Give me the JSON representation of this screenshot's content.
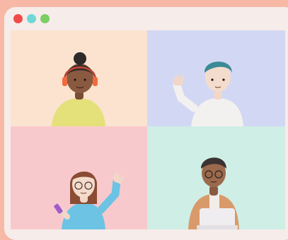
{
  "colors": {
    "background": "#f7b9a6",
    "window": "#f6ecea",
    "close": "#f04a4a",
    "minimize": "#6fd8d6",
    "maximize": "#7ccf62",
    "tile_1": "#fbe3cf",
    "tile_2": "#d2d8f3",
    "tile_3": "#f8c9cc",
    "tile_4": "#cfeee6"
  },
  "titlebar": {
    "controls": [
      "close-icon",
      "minimize-icon",
      "maximize-icon"
    ]
  },
  "grid": {
    "tiles": [
      {
        "participant": "woman-with-headphones"
      },
      {
        "participant": "man-waving"
      },
      {
        "participant": "woman-with-glasses-waving"
      },
      {
        "participant": "man-with-laptop"
      }
    ]
  }
}
